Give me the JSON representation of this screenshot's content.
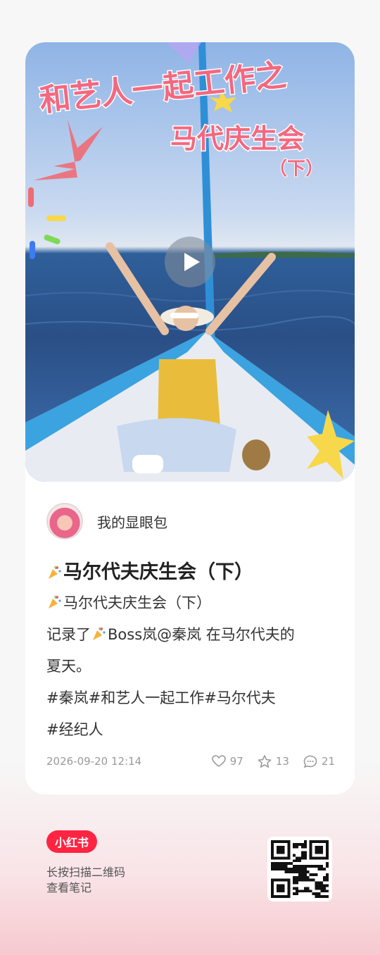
{
  "cover": {
    "overlay_line1": "和艺人一起工作之",
    "overlay_line2": "马代庆生会",
    "overlay_line3": "（下）",
    "play_icon": "play-icon"
  },
  "author": {
    "name": "我的显眼包",
    "avatar": "avatar-image"
  },
  "post": {
    "title": "马尔代夫庆生会（下）",
    "line1": "马尔代夫庆生会（下）",
    "line2_pre": "记录了",
    "line2_post": "Boss岚@秦岚 在马尔代夫的",
    "line3": "夏天。",
    "tags_line1": "#秦岚#和艺人一起工作#马尔代夫",
    "tags_line2": "#经纪人",
    "emoji": "party-popper-emoji"
  },
  "meta": {
    "time": "2026-09-20 12:14",
    "likes": "97",
    "collects": "13",
    "comments": "21"
  },
  "footer": {
    "logo": "小红书",
    "hint_line1": "长按扫描二维码",
    "hint_line2": "查看笔记",
    "qr": "qr-code"
  },
  "colors": {
    "brand": "#ff2442",
    "accent_pink": "#f2657a",
    "boat_blue": "#3aa3e0"
  }
}
